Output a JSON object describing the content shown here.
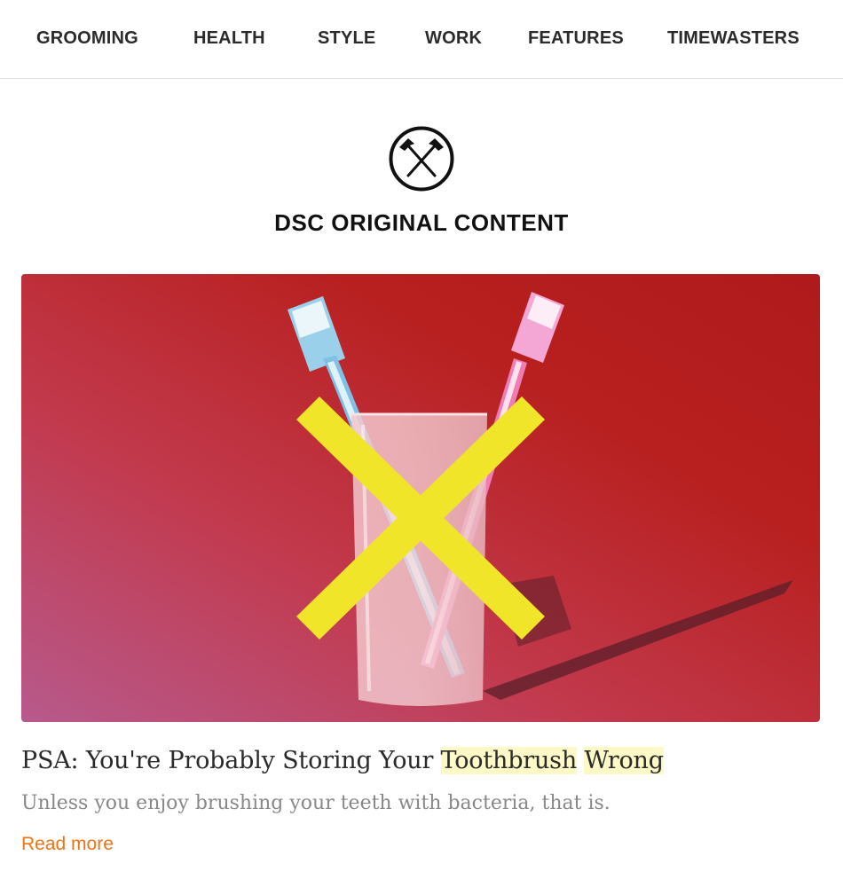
{
  "nav": {
    "items": [
      {
        "label": "GROOMING"
      },
      {
        "label": "HEALTH"
      },
      {
        "label": "STYLE"
      },
      {
        "label": "WORK"
      },
      {
        "label": "FEATURES"
      },
      {
        "label": "TIMEWASTERS"
      }
    ]
  },
  "brand": {
    "logo_icon": "crossed-hammers-icon",
    "title": "DSC ORIGINAL CONTENT"
  },
  "article": {
    "image_icon": "toothbrushes-in-glass-crossed-out-image",
    "headline_part1": "PSA: You're Probably Storing Your ",
    "headline_hl1": "Toothbrush",
    "headline_space": " ",
    "headline_hl2": "Wrong",
    "dek": "Unless you enjoy brushing your teeth with bacteria, that is.",
    "read_more": "Read more"
  },
  "colors": {
    "accent": "#f07315",
    "highlight": "#fdf9c6",
    "hero_red": "#b91f1f",
    "x_yellow": "#f1e52a"
  }
}
